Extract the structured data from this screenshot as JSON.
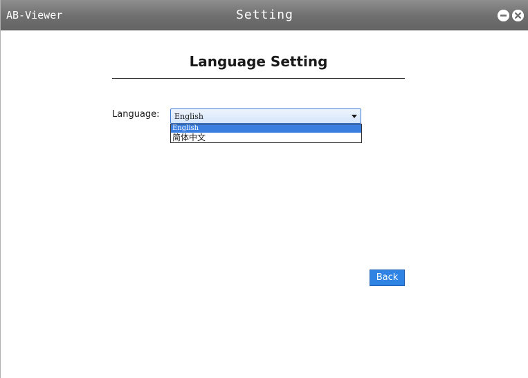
{
  "titlebar": {
    "app_name": "AB-Viewer",
    "title": "Setting",
    "minimize_icon": "minimize-circle-icon",
    "close_icon": "close-circle-icon"
  },
  "page": {
    "heading": "Language Setting"
  },
  "language": {
    "label": "Language:",
    "selected": "English",
    "options": [
      "English",
      "简体中文"
    ]
  },
  "buttons": {
    "back": "Back"
  },
  "colors": {
    "titlebar": "#757575",
    "accent": "#2f84e3",
    "selection": "#3a7fe0"
  }
}
